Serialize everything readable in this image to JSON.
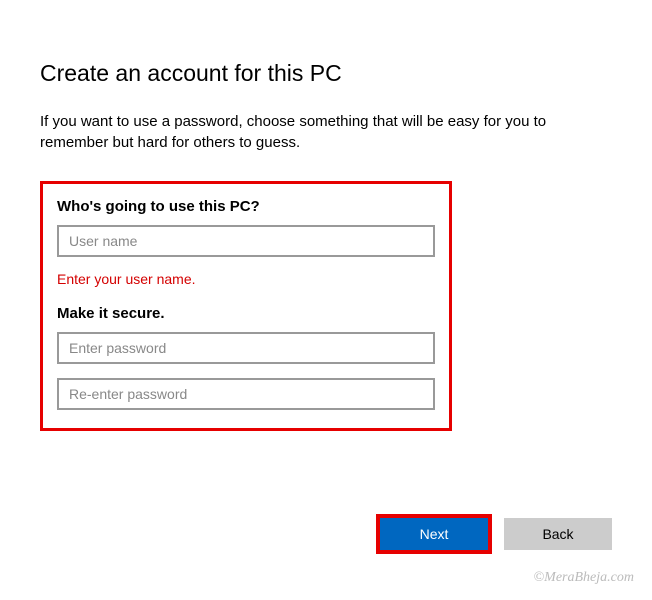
{
  "header": {
    "title": "Create an account for this PC",
    "description": "If you want to use a password, choose something that will be easy for you to remember but hard for others to guess."
  },
  "form": {
    "who_label": "Who's going to use this PC?",
    "username_placeholder": "User name",
    "username_value": "",
    "error_message": "Enter your user name.",
    "secure_label": "Make it secure.",
    "password_placeholder": "Enter password",
    "password_value": "",
    "reenter_placeholder": "Re-enter password",
    "reenter_value": ""
  },
  "buttons": {
    "next": "Next",
    "back": "Back"
  },
  "watermark": "©MeraBheja.com",
  "colors": {
    "highlight_border": "#e60000",
    "primary_button": "#0067c0",
    "error_text": "#d40000"
  }
}
